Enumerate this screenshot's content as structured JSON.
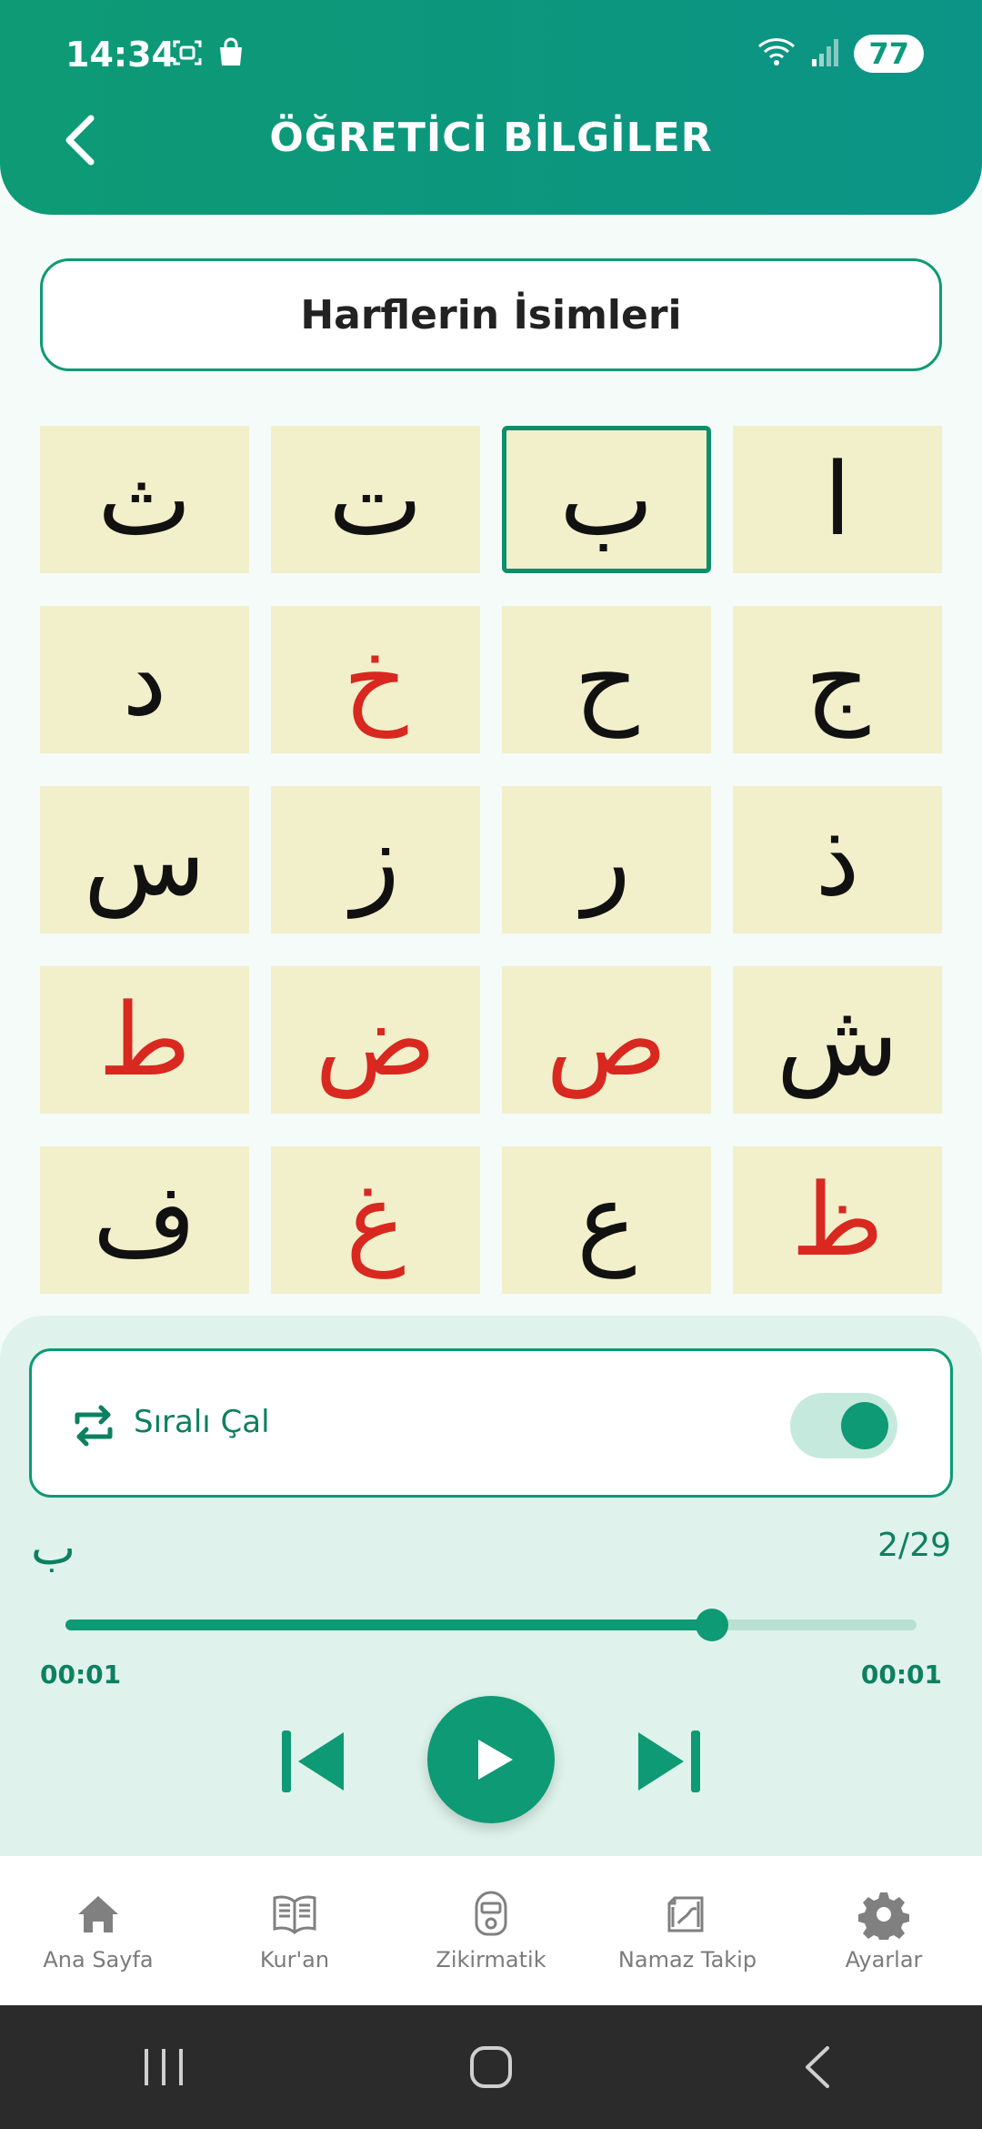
{
  "status": {
    "time": "14:34",
    "battery": "77"
  },
  "header": {
    "title": "ÖĞRETİCİ BİLGİLER"
  },
  "section": {
    "title": "Harflerin İsimleri"
  },
  "letters": [
    {
      "char": "ا",
      "color": "#111111",
      "selected": false
    },
    {
      "char": "ب",
      "color": "#111111",
      "selected": true
    },
    {
      "char": "ت",
      "color": "#111111",
      "selected": false
    },
    {
      "char": "ث",
      "color": "#111111",
      "selected": false
    },
    {
      "char": "ج",
      "color": "#111111",
      "selected": false
    },
    {
      "char": "ح",
      "color": "#111111",
      "selected": false
    },
    {
      "char": "خ",
      "color": "#d8281f",
      "selected": false
    },
    {
      "char": "د",
      "color": "#111111",
      "selected": false
    },
    {
      "char": "ذ",
      "color": "#111111",
      "selected": false
    },
    {
      "char": "ر",
      "color": "#111111",
      "selected": false
    },
    {
      "char": "ز",
      "color": "#111111",
      "selected": false
    },
    {
      "char": "س",
      "color": "#111111",
      "selected": false
    },
    {
      "char": "ش",
      "color": "#111111",
      "selected": false
    },
    {
      "char": "ص",
      "color": "#d8281f",
      "selected": false
    },
    {
      "char": "ض",
      "color": "#d8281f",
      "selected": false
    },
    {
      "char": "ط",
      "color": "#d8281f",
      "selected": false
    },
    {
      "char": "ظ",
      "color": "#d8281f",
      "selected": false
    },
    {
      "char": "ع",
      "color": "#111111",
      "selected": false
    },
    {
      "char": "غ",
      "color": "#d8281f",
      "selected": false
    },
    {
      "char": "ف",
      "color": "#111111",
      "selected": false
    }
  ],
  "player": {
    "loop_label": "Sıralı Çal",
    "loop_enabled": true,
    "current_letter": "ب",
    "counter": "2/29",
    "progress": 0.76,
    "time_elapsed": "00:01",
    "time_total": "00:01"
  },
  "nav": {
    "items": [
      {
        "label": "Ana Sayfa",
        "icon": "home-icon"
      },
      {
        "label": "Kur'an",
        "icon": "book-icon"
      },
      {
        "label": "Zikirmatik",
        "icon": "tasbih-counter-icon"
      },
      {
        "label": "Namaz Takip",
        "icon": "prayer-mat-icon"
      },
      {
        "label": "Ayarlar",
        "icon": "gear-icon"
      }
    ]
  },
  "colors": {
    "brand": "#0d9a74",
    "cell_bg": "#f2efcb",
    "accent_red": "#d8281f"
  }
}
